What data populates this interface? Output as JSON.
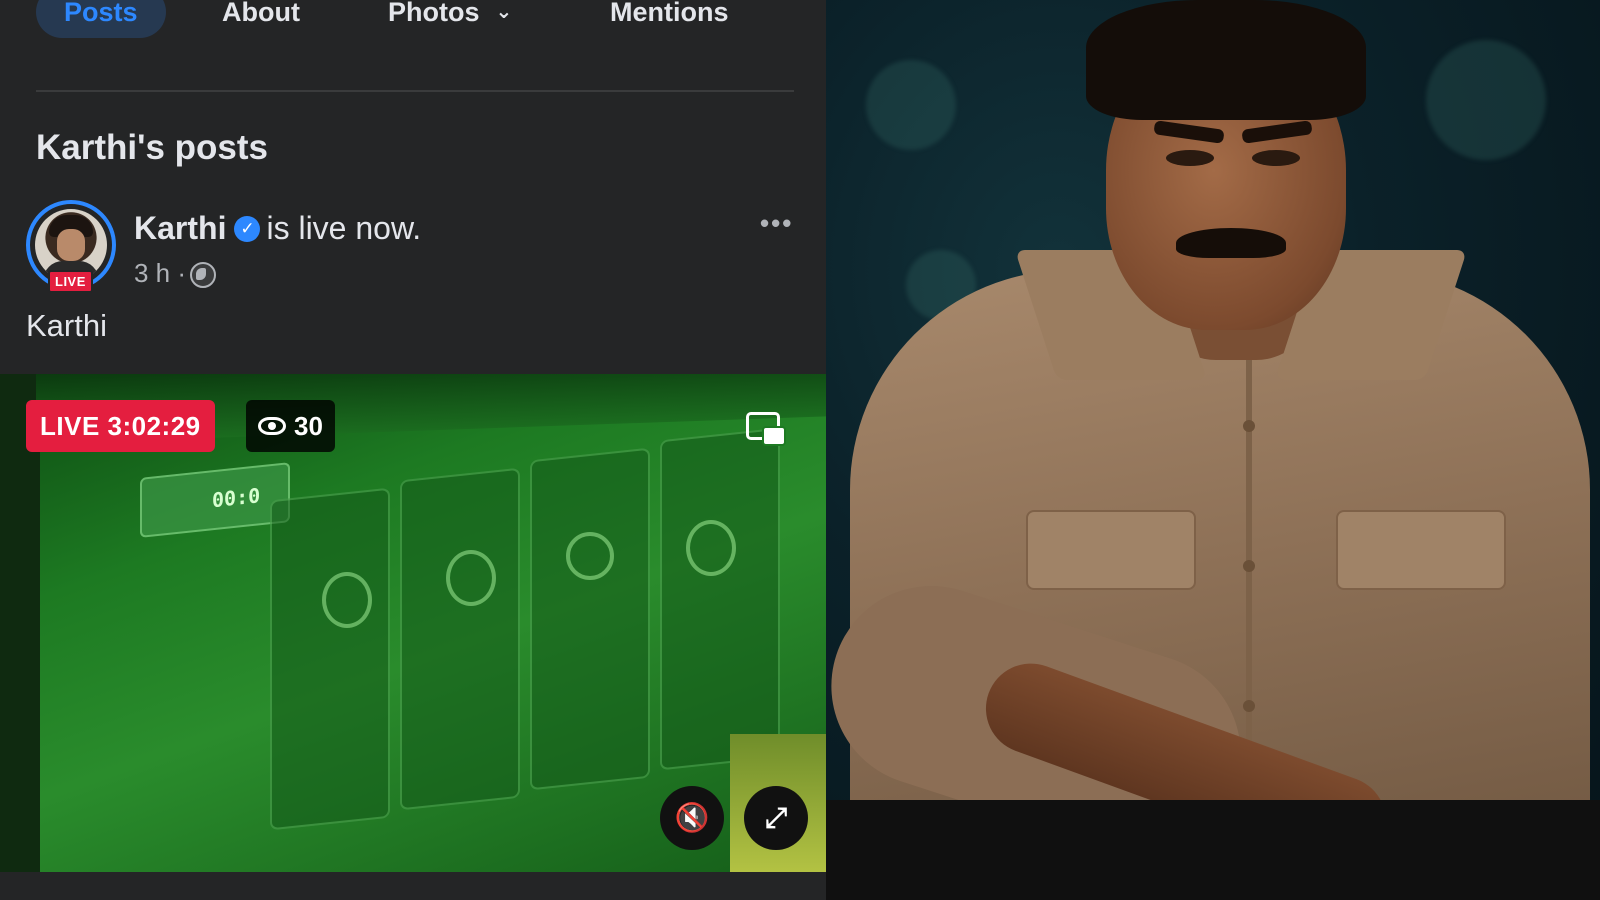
{
  "profile_tabs": {
    "posts": "Posts",
    "about": "About",
    "photos": "Photos",
    "photos_chevron": "⌄",
    "mentions": "Mentions"
  },
  "section_title": "Karthi's posts",
  "post": {
    "author": "Karthi",
    "verified_icon": "✓",
    "status": "is live now.",
    "time": "3 h ·",
    "avatar_badge": "LIVE",
    "more_icon": "•••",
    "text": "Karthi"
  },
  "video": {
    "live_label": "LIVE 3:02:29",
    "viewer_count": "30",
    "screen_text": "00:0",
    "mute_icon": "🔇",
    "fullscreen_icon": "⤢"
  },
  "colors": {
    "accent": "#2d88ff",
    "live_red": "#e41e3f",
    "panel_bg": "#242526"
  }
}
